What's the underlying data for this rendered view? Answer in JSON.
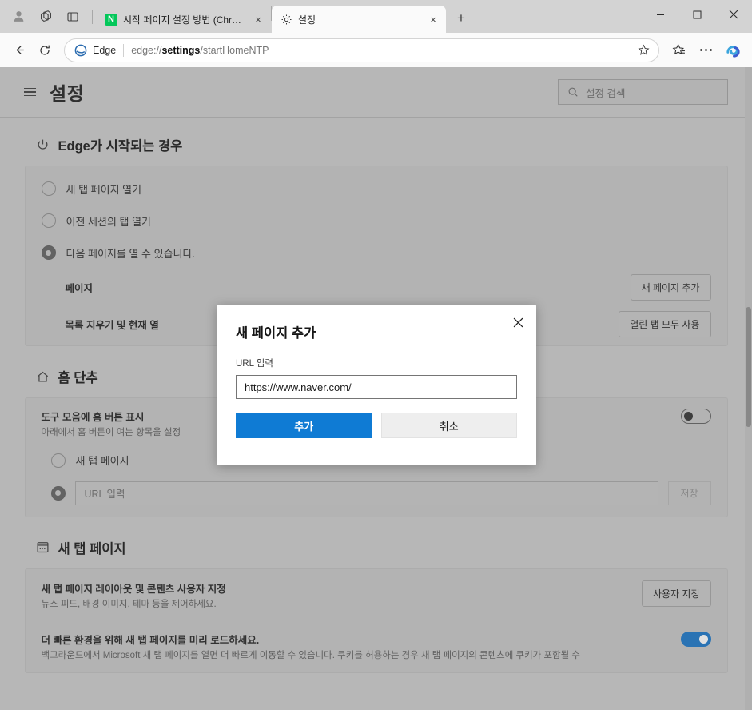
{
  "browser": {
    "left_icons": [
      {
        "name": "profile-avatar",
        "label": "프로필"
      },
      {
        "name": "tab-actions-icon",
        "label": "탭 작업 메뉴"
      },
      {
        "name": "vertical-tabs-icon",
        "label": "수직 탭 설정"
      }
    ],
    "tabs": [
      {
        "title": "시작 페이지 설정 방법 (Chrome) ...",
        "favicon": "naver-favicon",
        "favicon_letter": "N",
        "active": false,
        "close_label": "×"
      },
      {
        "title": "설정",
        "favicon": "gear-icon",
        "active": true,
        "close_label": "×"
      }
    ],
    "new_tab_label": "+",
    "window_controls": {
      "minimize": "–",
      "maximize": "▢",
      "close": "✕"
    },
    "nav": {
      "back_label": "뒤로",
      "refresh_label": "새로 고침",
      "edge_label": "Edge",
      "url_prefix": "edge://",
      "url_bold": "settings",
      "url_suffix": "/startHomeNTP",
      "star_label": "즐겨찾기에 추가",
      "collections_label": "컬렉션",
      "more_label": "설정 및 기타",
      "copilot_label": "Copilot"
    }
  },
  "settings": {
    "title": "설정",
    "menu_label": "설정 메뉴",
    "search": {
      "placeholder": "설정 검색",
      "icon": "search-icon"
    }
  },
  "sections": {
    "startup": {
      "icon": "power-icon",
      "title": "Edge가 시작되는 경우",
      "options": [
        {
          "label": "새 탭 페이지 열기",
          "checked": false
        },
        {
          "label": "이전 세션의 탭 열기",
          "checked": false
        },
        {
          "label": "다음 페이지를 열 수 있습니다.",
          "checked": true
        }
      ],
      "pages_label": "페이지",
      "add_page_button": "새 페이지 추가",
      "clear_label": "목록 지우기 및 현재 열",
      "use_open_tabs_button": "열린 탭 모두 사용"
    },
    "home_button": {
      "icon": "home-icon",
      "title": "홈 단추",
      "show_home_label": "도구 모음에 홈 버튼 표시",
      "show_home_sub": "아래에서 홈 버튼이 여는 항목을 설정",
      "toggle_state": "off",
      "options": [
        {
          "label": "새 탭 페이지",
          "checked": false
        }
      ],
      "url_placeholder": "URL 입력",
      "save_button": "저장"
    },
    "new_tab_page": {
      "icon": "browser-window-icon",
      "title": "새 탭 페이지",
      "rows": [
        {
          "label": "새 탭 페이지 레이아웃 및 콘텐츠 사용자 지정",
          "sub": "뉴스 피드, 배경 이미지, 테마 등을 제어하세요.",
          "button": "사용자 지정"
        },
        {
          "label": "더 빠른 환경을 위해 새 탭 페이지를 미리 로드하세요.",
          "sub": "백그라운드에서 Microsoft 새 탭 페이지를 열면 더 빠르게 이동할 수 있습니다. 쿠키를 허용하는 경우 새 탭 페이지의 콘텐츠에 쿠키가 포함될 수",
          "toggle_state": "on"
        }
      ]
    }
  },
  "modal": {
    "title": "새 페이지 추가",
    "close_label": "✕",
    "field_label": "URL 입력",
    "url_value": "https://www.naver.com/",
    "primary_button": "추가",
    "secondary_button": "취소"
  },
  "colors": {
    "accent_blue": "#0f7bd4",
    "toggle_on": "#1572c6",
    "naver_green": "#03c75a"
  }
}
